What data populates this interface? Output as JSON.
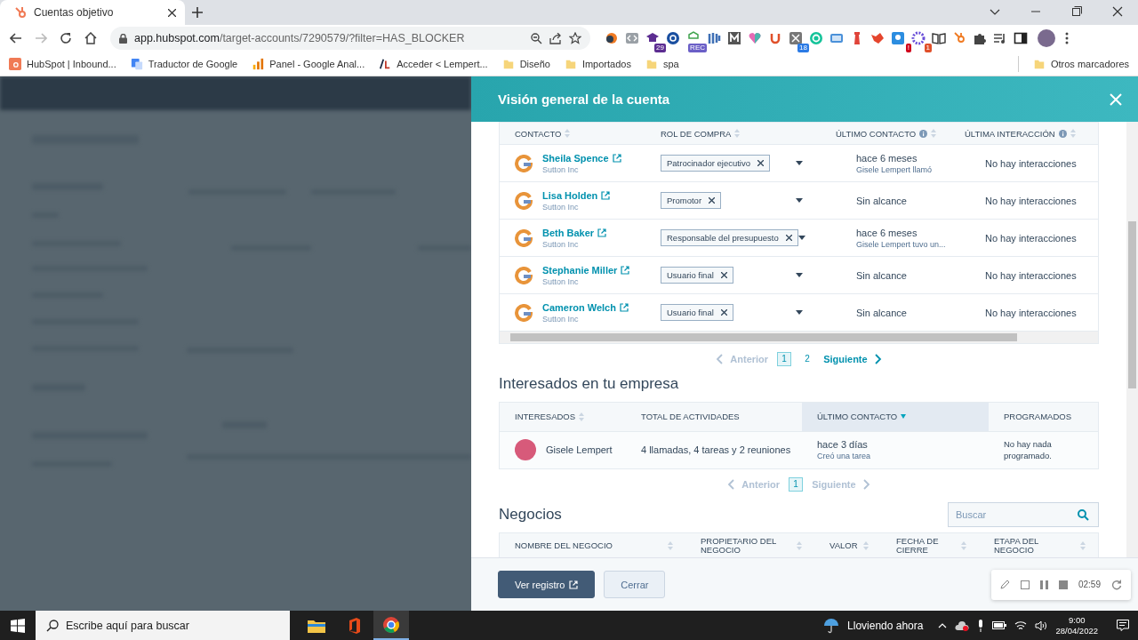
{
  "browser": {
    "tab_title": "Cuentas objetivo",
    "url_host": "app.hubspot.com",
    "url_path": "/target-accounts/7290579/?filter=HAS_BLOCKER",
    "extensions": [
      {
        "kind": "swirl"
      },
      {
        "kind": "code"
      },
      {
        "kind": "cap",
        "badge": "29"
      },
      {
        "kind": "at"
      },
      {
        "kind": "rec",
        "badge": "REC"
      },
      {
        "kind": "bars"
      },
      {
        "kind": "m"
      },
      {
        "kind": "heart"
      },
      {
        "kind": "u"
      },
      {
        "kind": "scissors",
        "badge": "18"
      },
      {
        "kind": "grammar"
      },
      {
        "kind": "screen"
      },
      {
        "kind": "tower"
      },
      {
        "kind": "fox"
      },
      {
        "kind": "lock",
        "badge": "!"
      },
      {
        "kind": "gear",
        "badge": "1"
      },
      {
        "kind": "book"
      },
      {
        "kind": "hub"
      },
      {
        "kind": "puzzle"
      },
      {
        "kind": "playlist"
      },
      {
        "kind": "sidepanel"
      }
    ],
    "bookmarks": [
      {
        "kind": "hubspot",
        "label": "HubSpot | Inbound..."
      },
      {
        "kind": "translate",
        "label": "Traductor de Google"
      },
      {
        "kind": "analytics",
        "label": "Panel - Google Anal..."
      },
      {
        "kind": "wp",
        "label": "Acceder < Lempert..."
      },
      {
        "kind": "folder",
        "label": "Diseño"
      },
      {
        "kind": "folder",
        "label": "Importados"
      },
      {
        "kind": "folder",
        "label": "spa"
      }
    ],
    "other_bookmarks": "Otros marcadores"
  },
  "panel": {
    "title": "Visión general de la cuenta",
    "contacts": {
      "columns": [
        {
          "label": "CONTACTO",
          "info": false
        },
        {
          "label": "ROL DE COMPRA",
          "info": false
        },
        {
          "label": "ÚLTIMO CONTACTO",
          "info": true
        },
        {
          "label": "ÚLTIMA INTERACCIÓN",
          "info": true
        }
      ],
      "rows": [
        {
          "name": "Sheila Spence",
          "company": "Sutton Inc",
          "role": "Patrocinador ejecutivo",
          "last_contact": "hace 6 meses",
          "last_contact_detail": "Gisele Lempert llamó",
          "last_interaction": "No hay interacciones"
        },
        {
          "name": "Lisa Holden",
          "company": "Sutton Inc",
          "role": "Promotor",
          "last_contact": "Sin alcance",
          "last_interaction": "No hay interacciones"
        },
        {
          "name": "Beth Baker",
          "company": "Sutton Inc",
          "role": "Responsable del presupuesto",
          "last_contact": "hace 6 meses",
          "last_contact_detail": "Gisele Lempert tuvo un...",
          "last_interaction": "No hay interacciones"
        },
        {
          "name": "Stephanie Miller",
          "company": "Sutton Inc",
          "role": "Usuario final",
          "last_contact": "Sin alcance",
          "last_interaction": "No hay interacciones"
        },
        {
          "name": "Cameron Welch",
          "company": "Sutton Inc",
          "role": "Usuario final",
          "last_contact": "Sin alcance",
          "last_interaction": "No hay interacciones"
        }
      ],
      "pagination": {
        "previous": "Anterior",
        "previous_disabled": true,
        "pages": [
          {
            "label": "1",
            "selected": true
          },
          {
            "label": "2",
            "selected": false
          }
        ],
        "next": "Siguiente",
        "next_disabled": false
      }
    },
    "interested": {
      "heading": "Interesados en tu empresa",
      "columns": [
        {
          "label": "INTERESADOS",
          "sortable": true,
          "sorted": false
        },
        {
          "label": "TOTAL DE ACTIVIDADES",
          "sortable": false,
          "sorted": false
        },
        {
          "label": "ÚLTIMO CONTACTO",
          "sortable": false,
          "sorted": true
        },
        {
          "label": "PROGRAMADOS",
          "sortable": false,
          "sorted": false
        }
      ],
      "rows": [
        {
          "name": "Gisele Lempert",
          "activities": "4 llamadas, 4 tareas y 2 reuniones",
          "last_contact": "hace 3 días",
          "last_contact_detail": "Creó una tarea",
          "scheduled": "No hay nada programado."
        }
      ],
      "pagination": {
        "previous": "Anterior",
        "previous_disabled": true,
        "pages": [
          {
            "label": "1",
            "selected": true
          }
        ],
        "next": "Siguiente",
        "next_disabled": true
      }
    },
    "deals": {
      "heading": "Negocios",
      "search": {
        "placeholder": "Buscar"
      },
      "columns": [
        {
          "label": "NOMBRE DEL NEGOCIO"
        },
        {
          "label": "PROPIETARIO DEL NEGOCIO"
        },
        {
          "label": "VALOR"
        },
        {
          "label": "FECHA DE CIERRE"
        },
        {
          "label": "ETAPA DEL NEGOCIO"
        }
      ]
    },
    "buttons": {
      "primary": "Ver registro",
      "secondary": "Cerrar"
    },
    "recorder": {
      "time": "02:59"
    }
  },
  "taskbar": {
    "search_placeholder": "Escribe aquí para buscar",
    "weather": "Lloviendo ahora",
    "time": "9:00",
    "date": "28/04/2022"
  }
}
